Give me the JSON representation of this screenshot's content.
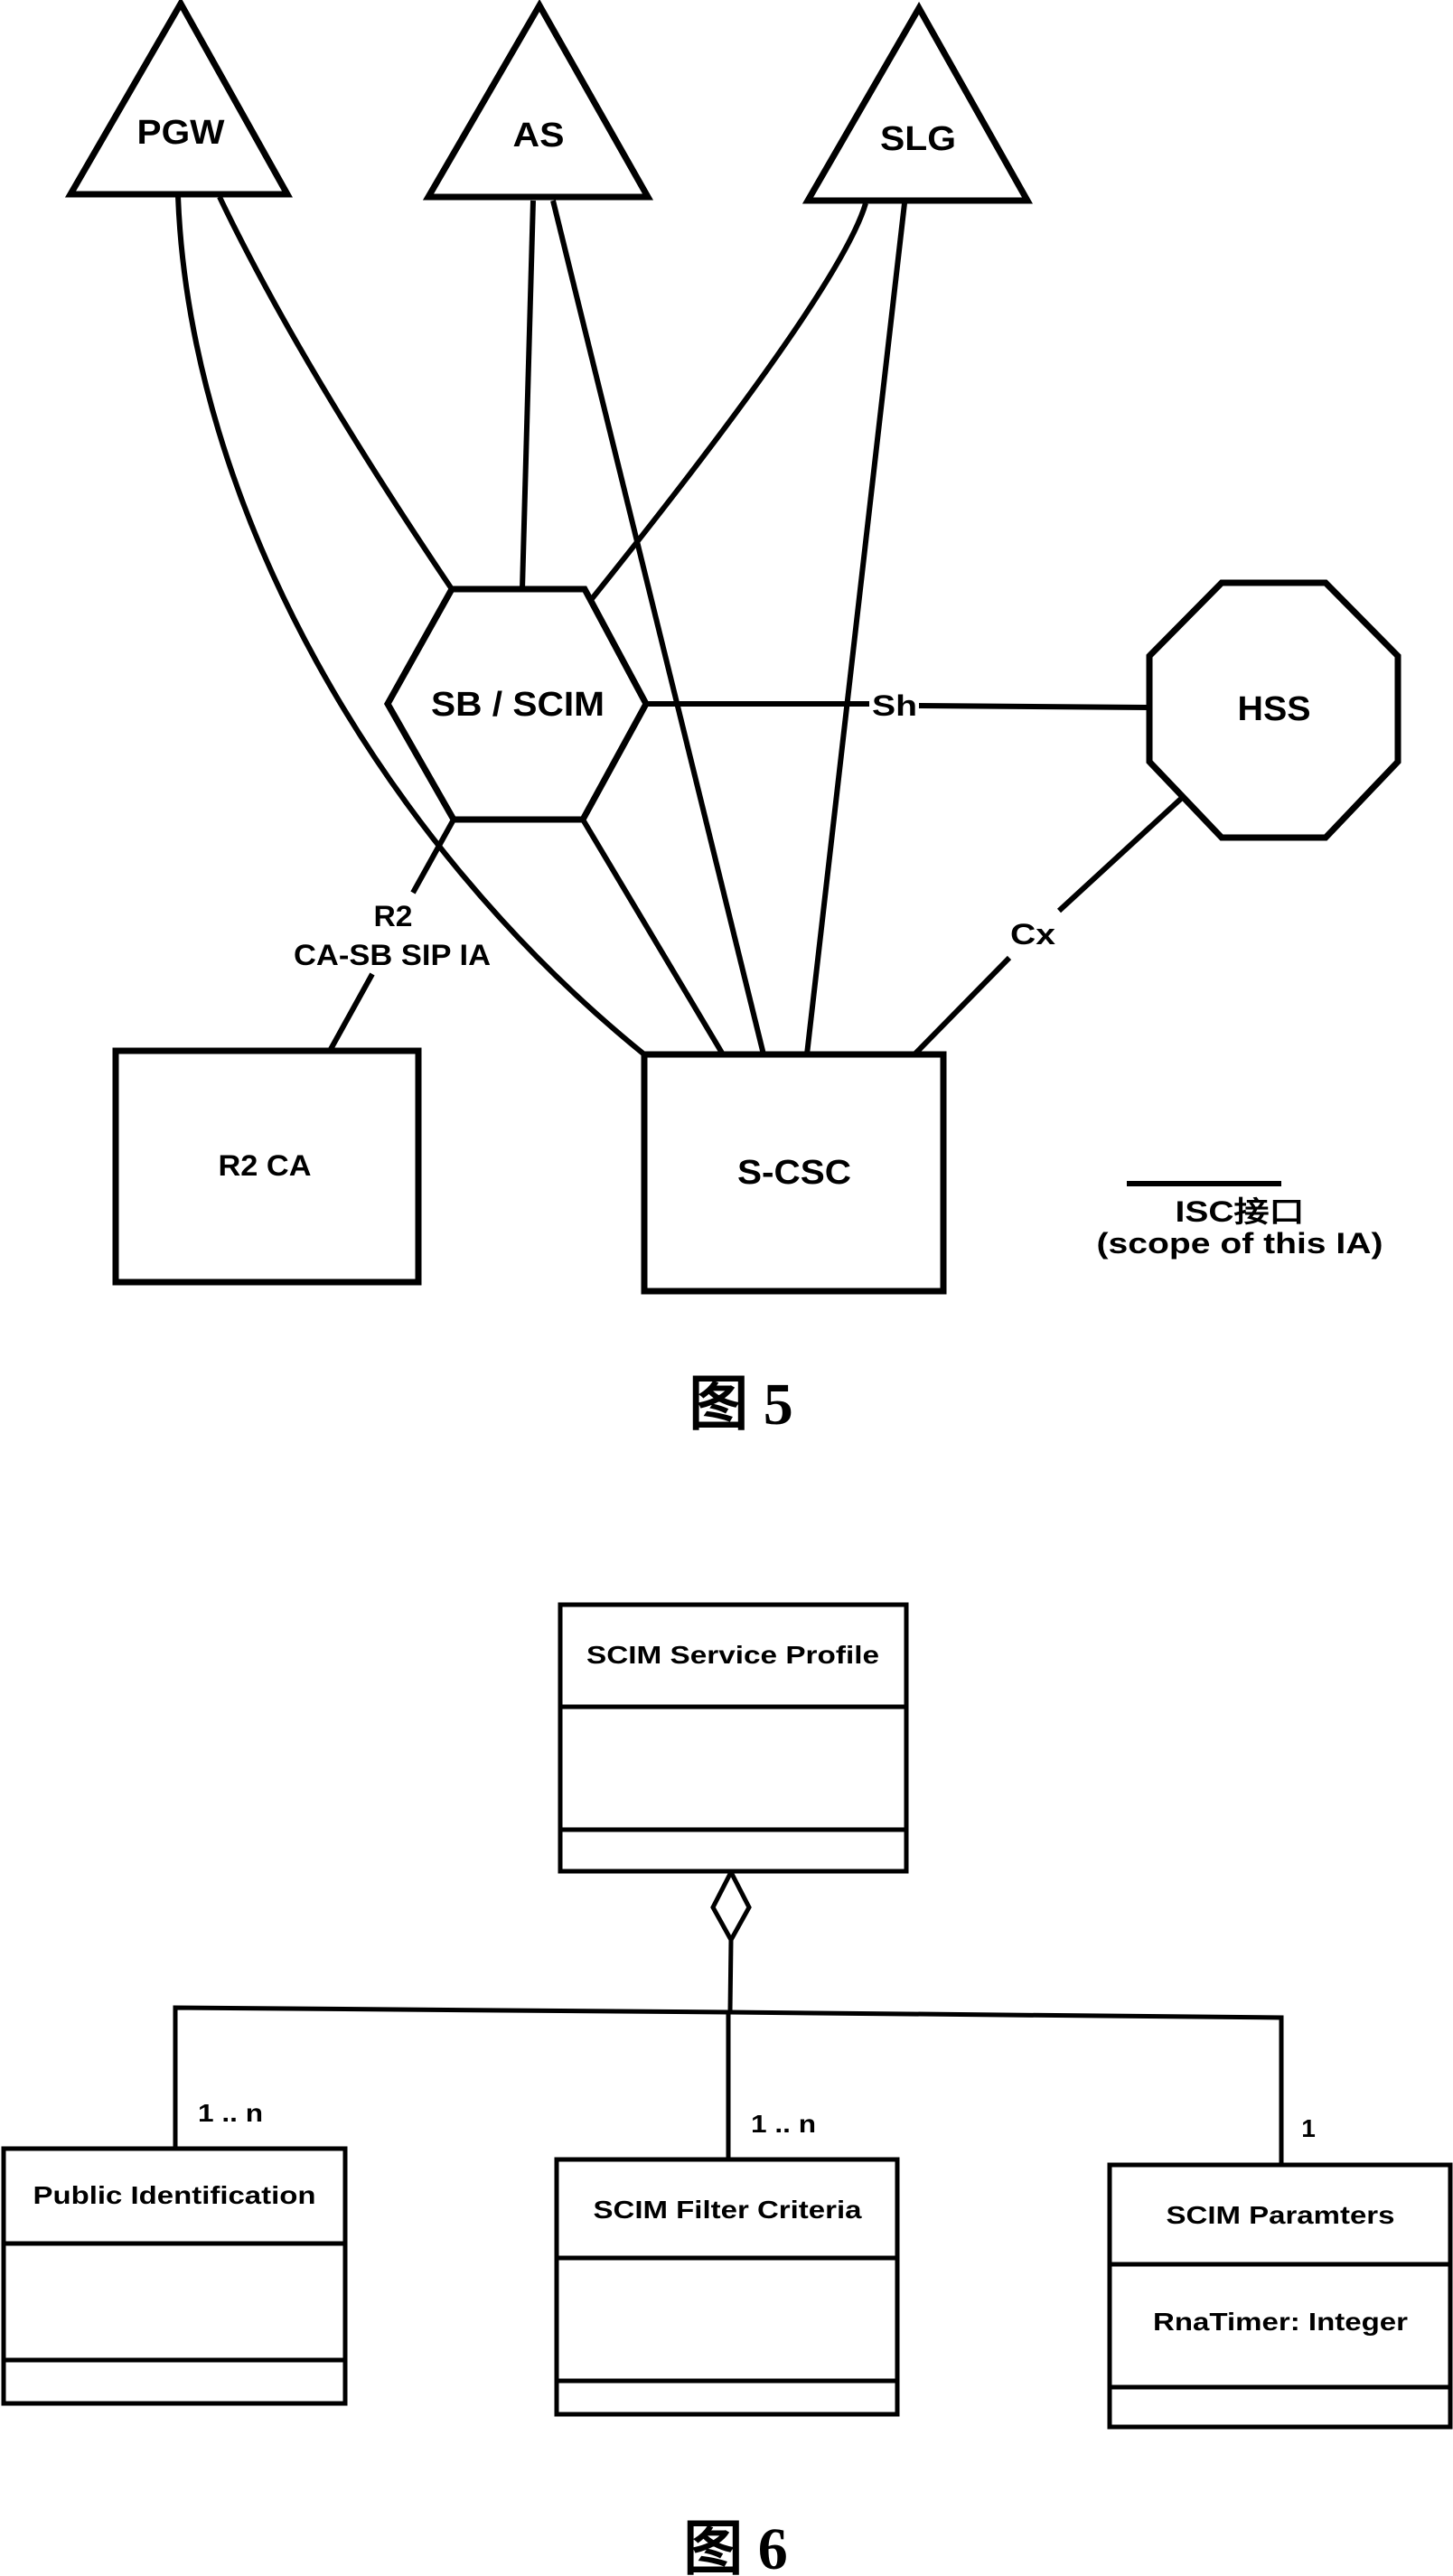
{
  "figure5": {
    "caption": "图 5",
    "nodes": {
      "pgw": "PGW",
      "as": "AS",
      "slg": "SLG",
      "sb_scim": "SB / SCIM",
      "hss": "HSS",
      "r2_ca": "R2 CA",
      "s_csc": "S-CSC"
    },
    "interfaces": {
      "sh": "Sh",
      "cx": "Cx",
      "r2_line1": "R2",
      "r2_line2": "CA-SB SIP IA"
    },
    "legend": {
      "line1": "ISC接口",
      "line2": "(scope of this IA)"
    }
  },
  "figure6": {
    "caption": "图 6",
    "classes": {
      "service_profile": {
        "name": "SCIM Service Profile",
        "attributes": ""
      },
      "public_identification": {
        "name": "Public Identification",
        "multiplicity": "1 .. n",
        "attributes": ""
      },
      "filter_criteria": {
        "name": "SCIM Filter Criteria",
        "multiplicity": "1 .. n",
        "attributes": ""
      },
      "parameters": {
        "name": "SCIM Paramters",
        "multiplicity": "1",
        "attributes": "RnaTimer: Integer"
      }
    }
  },
  "colors": {
    "ink": "#000000",
    "paper": "#ffffff"
  }
}
